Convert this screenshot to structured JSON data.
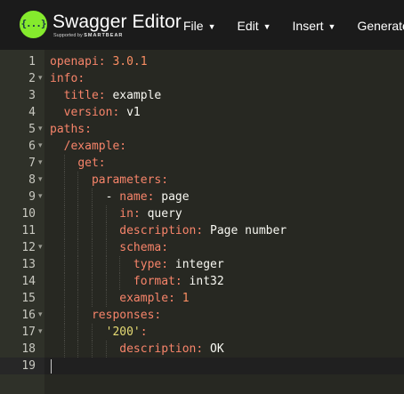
{
  "header": {
    "logo_glyph": "{...}",
    "app_name": "Swagger Editor",
    "supported_by": "Supported by",
    "vendor": "SMARTBEAR",
    "menu": [
      {
        "label": "File",
        "caret": "▼"
      },
      {
        "label": "Edit",
        "caret": "▼"
      },
      {
        "label": "Insert",
        "caret": "▼"
      },
      {
        "label": "Generate Server",
        "caret": "▼"
      }
    ]
  },
  "editor": {
    "active_line": 19,
    "lines": [
      {
        "num": "1",
        "fold": "",
        "indent": 0,
        "key": "openapi",
        "sep": ": ",
        "value": "3.0.1",
        "value_type": "number"
      },
      {
        "num": "2",
        "fold": "▾",
        "indent": 0,
        "key": "info",
        "sep": ":",
        "value": "",
        "value_type": "plain"
      },
      {
        "num": "3",
        "fold": "",
        "indent": 1,
        "key": "title",
        "sep": ": ",
        "value": "example",
        "value_type": "plain"
      },
      {
        "num": "4",
        "fold": "",
        "indent": 1,
        "key": "version",
        "sep": ": ",
        "value": "v1",
        "value_type": "plain"
      },
      {
        "num": "5",
        "fold": "▾",
        "indent": 0,
        "key": "paths",
        "sep": ":",
        "value": "",
        "value_type": "plain"
      },
      {
        "num": "6",
        "fold": "▾",
        "indent": 1,
        "key": "/example",
        "sep": ":",
        "value": "",
        "value_type": "plain"
      },
      {
        "num": "7",
        "fold": "▾",
        "indent": 2,
        "key": "get",
        "sep": ":",
        "value": "",
        "value_type": "plain"
      },
      {
        "num": "8",
        "fold": "▾",
        "indent": 3,
        "key": "parameters",
        "sep": ":",
        "value": "",
        "value_type": "plain"
      },
      {
        "num": "9",
        "fold": "▾",
        "indent": 4,
        "dash": "- ",
        "key": "name",
        "sep": ": ",
        "value": "page",
        "value_type": "plain"
      },
      {
        "num": "10",
        "fold": "",
        "indent": 5,
        "key": "in",
        "sep": ": ",
        "value": "query",
        "value_type": "plain"
      },
      {
        "num": "11",
        "fold": "",
        "indent": 5,
        "key": "description",
        "sep": ": ",
        "value": "Page number",
        "value_type": "plain"
      },
      {
        "num": "12",
        "fold": "▾",
        "indent": 5,
        "key": "schema",
        "sep": ":",
        "value": "",
        "value_type": "plain"
      },
      {
        "num": "13",
        "fold": "",
        "indent": 6,
        "key": "type",
        "sep": ": ",
        "value": "integer",
        "value_type": "plain"
      },
      {
        "num": "14",
        "fold": "",
        "indent": 6,
        "key": "format",
        "sep": ": ",
        "value": "int32",
        "value_type": "plain"
      },
      {
        "num": "15",
        "fold": "",
        "indent": 5,
        "key": "example",
        "sep": ": ",
        "value": "1",
        "value_type": "number"
      },
      {
        "num": "16",
        "fold": "▾",
        "indent": 3,
        "key": "responses",
        "sep": ":",
        "value": "",
        "value_type": "plain"
      },
      {
        "num": "17",
        "fold": "▾",
        "indent": 4,
        "key": "'200'",
        "key_type": "string",
        "sep": ":",
        "value": "",
        "value_type": "plain"
      },
      {
        "num": "18",
        "fold": "",
        "indent": 5,
        "key": "description",
        "sep": ": ",
        "value": "OK",
        "value_type": "plain"
      },
      {
        "num": "19",
        "fold": "",
        "indent": 0,
        "key": "",
        "sep": "",
        "value": "",
        "value_type": "plain"
      }
    ]
  },
  "colors": {
    "topbar_bg": "#1b1b1b",
    "logo_green": "#85ea2d",
    "editor_bg": "#272822",
    "gutter_bg": "#2f3129",
    "key": "#f7846a",
    "number": "#fa8e63",
    "string": "#e6db74",
    "text": "#f8f8f2"
  },
  "icons": {
    "logo": "swagger-logo-icon",
    "menu_caret": "caret-down-icon",
    "fold_marker": "fold-arrow-icon"
  }
}
